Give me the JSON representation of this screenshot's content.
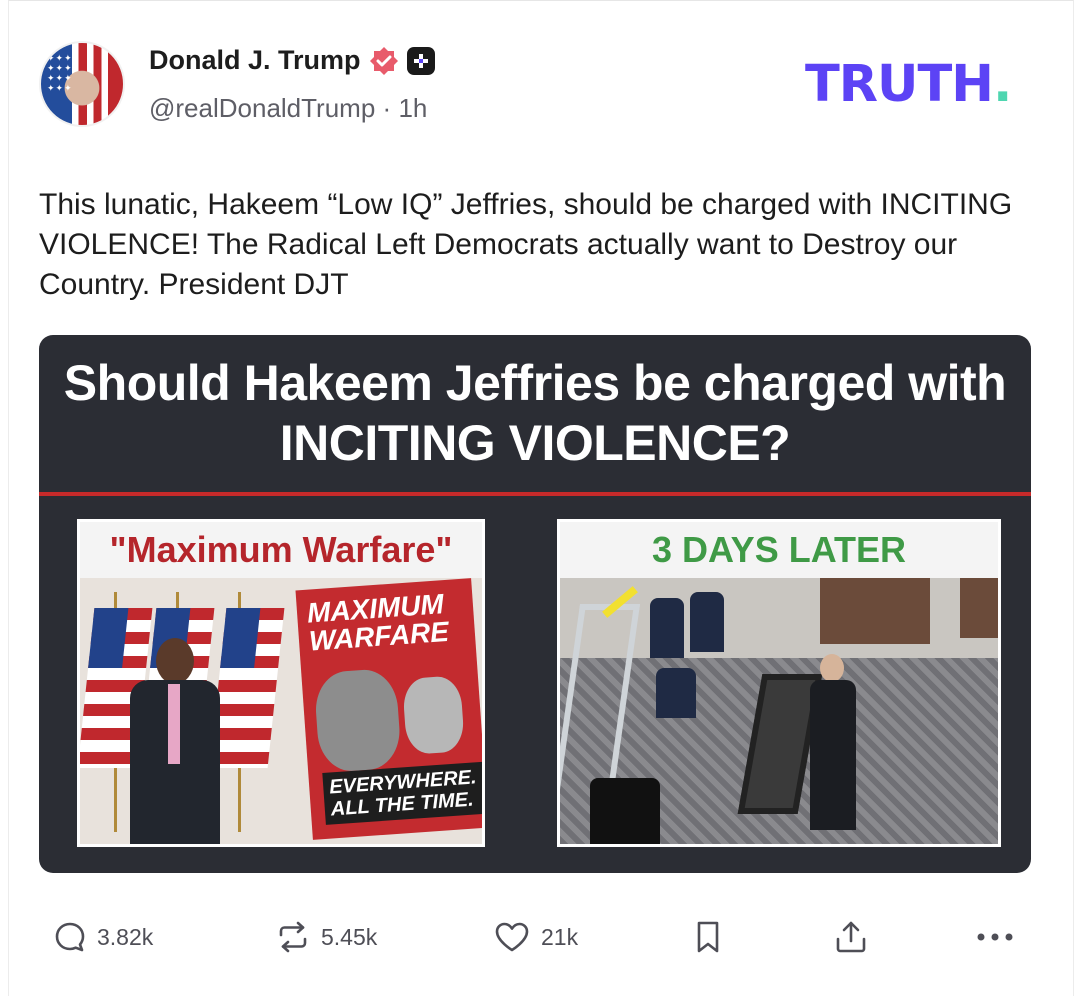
{
  "author": {
    "name": "Donald J. Trump",
    "handle": "@realDonaldTrump",
    "separator": "·",
    "time": "1h"
  },
  "brand": {
    "logo_text": "TRUTH",
    "logo_dot": ".",
    "logo_color": "#5c43f5",
    "dot_color": "#4fd6b0"
  },
  "post": {
    "text": "This lunatic, Hakeem “Low IQ” Jeffries, should be charged with INCITING VIOLENCE! The Radical Left Democrats actually want to Destroy our Country. President DJT"
  },
  "media": {
    "title": "Should Hakeem Jeffries be charged with INCITING VIOLENCE?",
    "left_caption": "\"Maximum Warfare\"",
    "right_caption": "3 DAYS LATER",
    "poster_top": "MAXIMUM WARFARE",
    "poster_bottom": "EVERYWHERE. ALL THE TIME."
  },
  "actions": {
    "replies": "3.82k",
    "retruths": "5.45k",
    "likes": "21k"
  },
  "icons": [
    "verified-badge-icon",
    "plus-badge-icon",
    "reply-icon",
    "retruth-icon",
    "like-icon",
    "bookmark-icon",
    "share-icon",
    "more-icon"
  ]
}
